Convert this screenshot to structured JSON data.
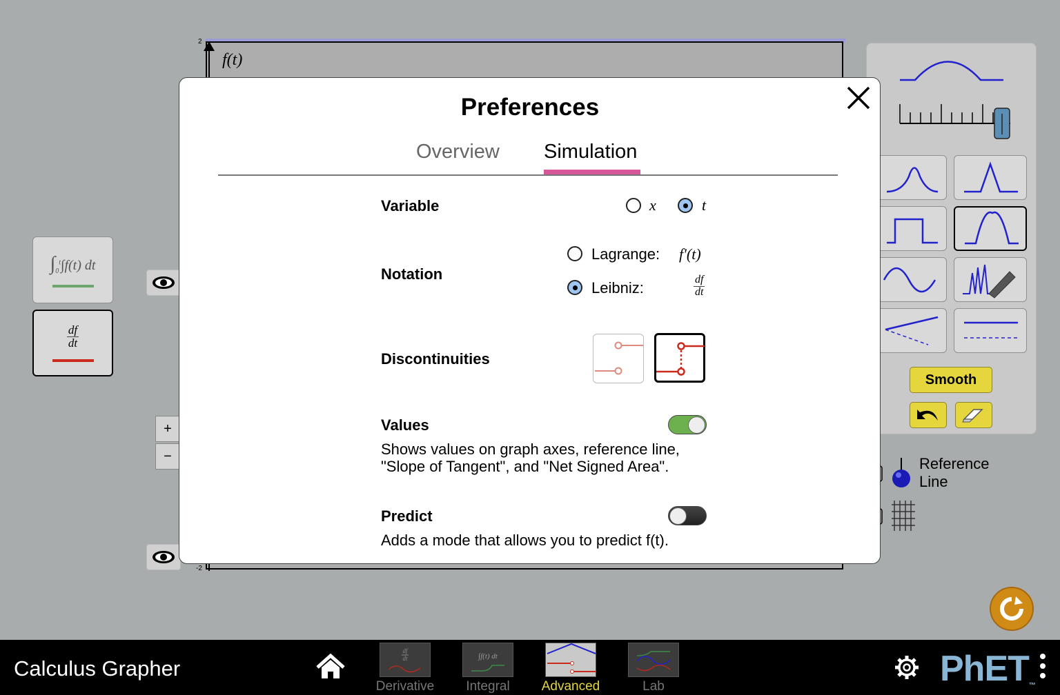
{
  "graph": {
    "title": "f(t)",
    "y_max_label": "2",
    "y_min_label": "-2"
  },
  "left_cards": [
    {
      "formula": "∫f(t) dt",
      "lower": "0",
      "upper": "t",
      "color": "#4d9a5a"
    },
    {
      "numerator": "df",
      "denominator": "dt",
      "color": "#cc2a1c"
    }
  ],
  "zoom": {
    "in": "+",
    "out": "−"
  },
  "right_panel": {
    "smooth_label": "Smooth",
    "reference_line_label": [
      "Reference",
      "Line"
    ]
  },
  "dialog": {
    "title": "Preferences",
    "tabs": [
      {
        "label": "Overview",
        "active": false
      },
      {
        "label": "Simulation",
        "active": true
      }
    ],
    "variable": {
      "label": "Variable",
      "options": [
        "x",
        "t"
      ],
      "selected": "t"
    },
    "notation": {
      "label": "Notation",
      "lagrange_label": "Lagrange:",
      "lagrange_symbol": "f′(t)",
      "leibniz_label": "Leibniz:",
      "leibniz_num": "df",
      "leibniz_den": "dt",
      "selected": "Leibniz"
    },
    "discontinuities": {
      "label": "Discontinuities",
      "selected": "connected"
    },
    "values": {
      "label": "Values",
      "enabled": true,
      "description_line1": "Shows values on graph axes, reference line,",
      "description_line2": "\"Slope of Tangent\", and \"Net Signed Area\"."
    },
    "predict": {
      "label": "Predict",
      "enabled": false,
      "description": "Adds a mode that allows you to predict f(t)."
    }
  },
  "navbar": {
    "app_title": "Calculus Grapher",
    "screens": [
      {
        "label": "Derivative",
        "active": false
      },
      {
        "label": "Integral",
        "active": false
      },
      {
        "label": "Advanced",
        "active": true
      },
      {
        "label": "Lab",
        "active": false
      }
    ],
    "logo": "PhET"
  },
  "colors": {
    "accent_tab": "#d6589a",
    "toggle_on": "#6db14f",
    "radio_selected": "#9fc6f3",
    "smooth_button": "#e4d63c",
    "curve_blue": "#2222cc"
  }
}
